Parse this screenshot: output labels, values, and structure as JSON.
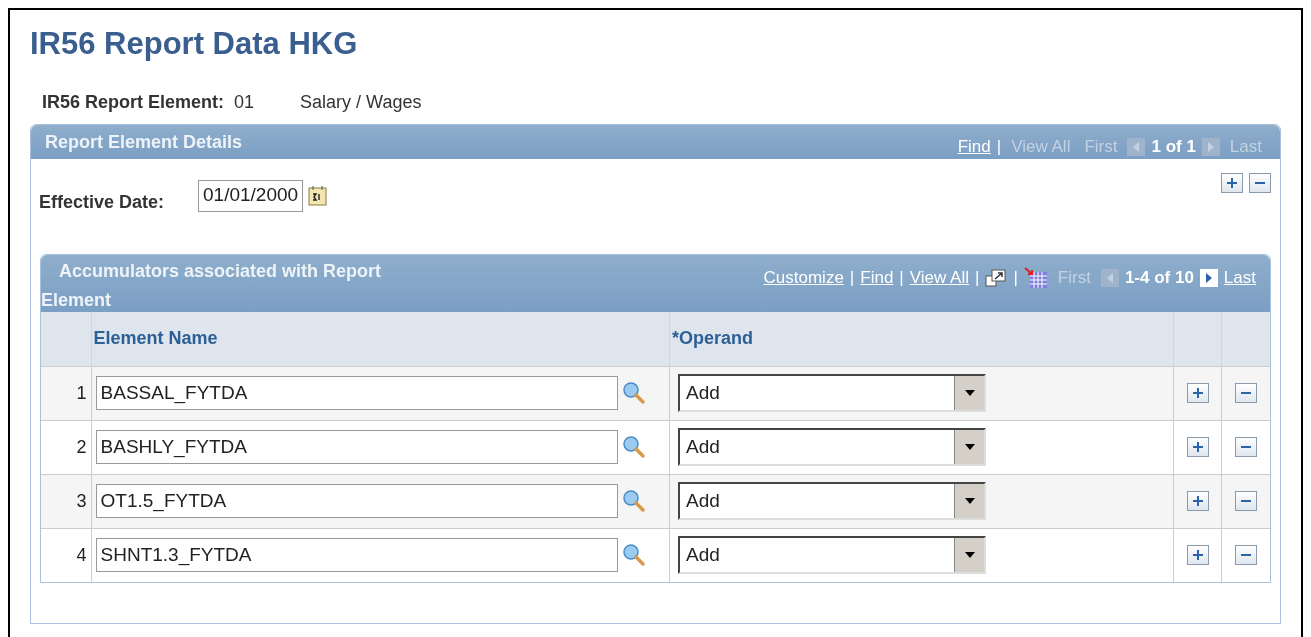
{
  "title": "IR56 Report Data HKG",
  "report_element": {
    "label": "IR56 Report Element:",
    "code": "01",
    "description": "Salary / Wages"
  },
  "details": {
    "title": "Report Element Details",
    "nav": [
      {
        "kind": "link",
        "text": "Find",
        "disabled": false
      },
      {
        "kind": "separator",
        "text": "|"
      },
      {
        "kind": "link",
        "text": "View All",
        "disabled": true
      },
      {
        "kind": "link",
        "text": "First",
        "disabled": true
      },
      {
        "kind": "prev",
        "disabled": true
      },
      {
        "kind": "count",
        "text": "1 of 1"
      },
      {
        "kind": "next",
        "disabled": true
      },
      {
        "kind": "link",
        "text": "Last",
        "disabled": true
      }
    ],
    "effective_date": {
      "label": "Effective Date:",
      "value": "01/01/2000"
    },
    "grid": {
      "title": "Accumulators associated with Report Element",
      "nav": [
        {
          "kind": "link",
          "text": "Customize",
          "disabled": false
        },
        {
          "kind": "separator",
          "text": "|"
        },
        {
          "kind": "link",
          "text": "Find",
          "disabled": false
        },
        {
          "kind": "separator",
          "text": "|"
        },
        {
          "kind": "link",
          "text": "View All",
          "disabled": false
        },
        {
          "kind": "separator",
          "text": "|"
        },
        {
          "kind": "zoom"
        },
        {
          "kind": "separator",
          "text": "|"
        },
        {
          "kind": "download"
        },
        {
          "kind": "link",
          "text": "First",
          "disabled": true
        },
        {
          "kind": "prev",
          "disabled": true
        },
        {
          "kind": "count",
          "text": "1-4 of 10"
        },
        {
          "kind": "next",
          "disabled": false
        },
        {
          "kind": "link",
          "text": "Last",
          "disabled": false
        }
      ],
      "columns": [
        "Element Name",
        "*Operand"
      ],
      "rows": [
        {
          "number": "1",
          "element_name": "BASSAL_FYTDA",
          "operand": "Add"
        },
        {
          "number": "2",
          "element_name": "BASHLY_FYTDA",
          "operand": "Add"
        },
        {
          "number": "3",
          "element_name": "OT1.5_FYTDA",
          "operand": "Add"
        },
        {
          "number": "4",
          "element_name": "SHNT1.3_FYTDA",
          "operand": "Add"
        }
      ]
    }
  }
}
